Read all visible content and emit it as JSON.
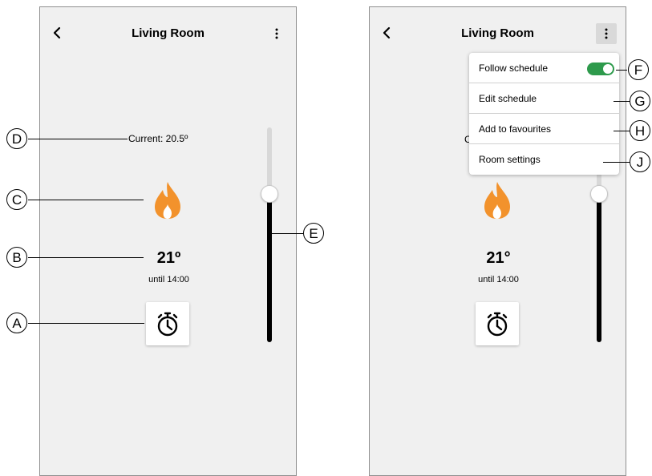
{
  "header": {
    "title": "Living Room"
  },
  "thermostat": {
    "current_left": "Current: 20.5º",
    "current_right_partial": "C",
    "setpoint_left": "21º",
    "setpoint_right": "21°",
    "until": "until 14:00"
  },
  "menu": {
    "items": [
      {
        "label": "Follow schedule",
        "toggle_on": true
      },
      {
        "label": "Edit schedule"
      },
      {
        "label": "Add to favourites"
      },
      {
        "label": "Room settings"
      }
    ]
  },
  "callouts": [
    "A",
    "B",
    "C",
    "D",
    "E",
    "F",
    "G",
    "H",
    "J"
  ],
  "colors": {
    "flame": "#f2922c",
    "toggle": "#2e9a4c",
    "screen_bg": "#f0f0f0",
    "slider_fill": "#000000",
    "slider_track": "#d8d8d8"
  },
  "icons": {
    "back": "chevron-left-icon",
    "more": "more-vertical-icon",
    "heating": "flame-icon",
    "timer": "stopwatch-icon"
  }
}
